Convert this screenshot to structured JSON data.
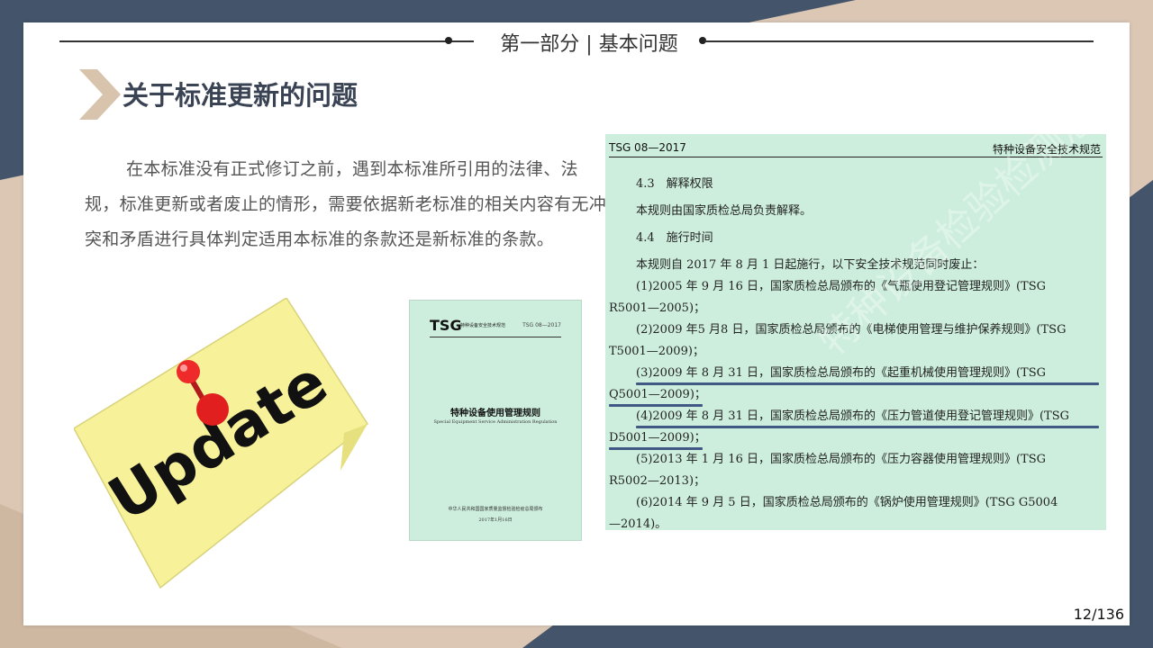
{
  "header": {
    "section_title": "第一部分 | 基本问题"
  },
  "slide": {
    "heading": "关于标准更新的问题",
    "paragraph": "在本标准没有正式修订之前，遇到本标准所引用的法律、法规，标准更新或者废止的情形，需要依据新老标准的相关内容有无冲突和矛盾进行具体判定适用本标准的条款还是新标准的条款。",
    "sticky_note": "Update",
    "page_number": "12/136"
  },
  "cover": {
    "tsg": "TSG",
    "subtitle": "特种设备安全技术规范",
    "code": "TSG 08—2017",
    "title": "特种设备使用管理规则",
    "title_en": "Special Equipment Service Administration Regulation",
    "publisher": "中华人民共和国国家质量监督检验检疫总局颁布",
    "date": "2017年1月16日"
  },
  "document": {
    "header_left": "TSG 08—2017",
    "header_right": "特种设备安全技术规范",
    "lines": [
      "4.3　解释权限",
      "本规则由国家质检总局负责解释。",
      "4.4　施行时间",
      "本规则自 2017 年 8 月 1 日起施行，以下安全技术规范同时废止：",
      "(1)2005 年 9 月 16 日，国家质检总局颁布的《气瓶使用登记管理规则》(TSG",
      "R5001—2005)；",
      "(2)2009 年5 月8 日，国家质检总局颁布的《电梯使用管理与维护保养规则》(TSG",
      "T5001—2009)；",
      "(3)2009 年 8 月 31 日，国家质检总局颁布的《起重机械使用管理规则》(TSG",
      "Q5001—2009)；",
      "(4)2009 年 8 月 31 日，国家质检总局颁布的《压力管道使用登记管理规则》(TSG",
      "D5001—2009)；",
      "(5)2013 年 1 月 16 日，国家质检总局颁布的《压力容器使用管理规则》(TSG",
      "R5002—2013)；",
      "(6)2014 年 9 月 5 日，国家质检总局颁布的《锅炉使用管理规则》(TSG G5004",
      "—2014)。"
    ],
    "watermark": "特种设备检验检测总局",
    "highlight_color": "#3f5884"
  },
  "colors": {
    "navy": "#44546a",
    "tan": "#dcc7b5",
    "doc_bg": "#cdeedd",
    "note": "#f7f29a"
  }
}
